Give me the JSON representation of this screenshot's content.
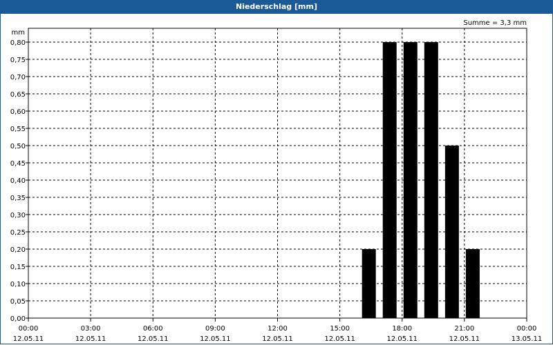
{
  "title": "Niederschlag [mm]",
  "chart_data": {
    "type": "bar",
    "title": "Niederschlag [mm]",
    "ylabel": "mm",
    "summary": "Summe = 3,3 mm",
    "ylim": [
      0,
      0.8
    ],
    "xlim_hours": [
      0,
      24
    ],
    "grid": true,
    "y_ticks": [
      "0,00",
      "0,05",
      "0,10",
      "0,15",
      "0,20",
      "0,25",
      "0,30",
      "0,35",
      "0,40",
      "0,45",
      "0,50",
      "0,55",
      "0,60",
      "0,65",
      "0,70",
      "0,75",
      "0,80"
    ],
    "x_ticks": [
      {
        "time": "00:00",
        "date": "12.05.11",
        "hour": 0
      },
      {
        "time": "03:00",
        "date": "12.05.11",
        "hour": 3
      },
      {
        "time": "06:00",
        "date": "12.05.11",
        "hour": 6
      },
      {
        "time": "09:00",
        "date": "12.05.11",
        "hour": 9
      },
      {
        "time": "12:00",
        "date": "12.05.11",
        "hour": 12
      },
      {
        "time": "15:00",
        "date": "12.05.11",
        "hour": 15
      },
      {
        "time": "18:00",
        "date": "12.05.11",
        "hour": 18
      },
      {
        "time": "21:00",
        "date": "12.05.11",
        "hour": 21
      },
      {
        "time": "00:00",
        "date": "13.05.11",
        "hour": 24
      }
    ],
    "bars": [
      {
        "hour": 16,
        "value": 0.2
      },
      {
        "hour": 17,
        "value": 0.8
      },
      {
        "hour": 18,
        "value": 0.8
      },
      {
        "hour": 19,
        "value": 0.8
      },
      {
        "hour": 20,
        "value": 0.5
      },
      {
        "hour": 21,
        "value": 0.2
      }
    ],
    "bar_color": "#000000",
    "title_bar_color": "#1a5a96"
  }
}
